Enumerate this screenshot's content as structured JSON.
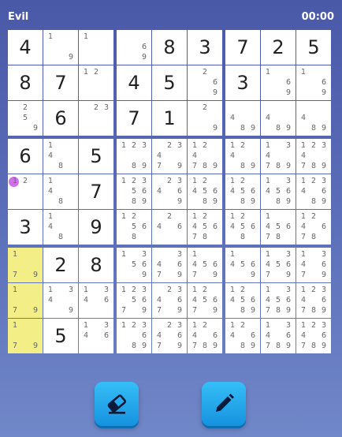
{
  "header": {
    "title": "Evil",
    "timer": "00:00"
  },
  "board": {
    "rows": [
      [
        {
          "v": "4"
        },
        {
          "c": [
            "1",
            "9"
          ]
        },
        {
          "c": [
            "1"
          ]
        },
        {
          "c": [
            "6",
            "9"
          ]
        },
        {
          "v": "8"
        },
        {
          "v": "3"
        },
        {
          "v": "7"
        },
        {
          "v": "2"
        },
        {
          "v": "5"
        }
      ],
      [
        {
          "v": "8"
        },
        {
          "v": "7"
        },
        {
          "c": [
            "1",
            "2"
          ]
        },
        {
          "v": "4"
        },
        {
          "v": "5"
        },
        {
          "c": [
            "2",
            "6",
            "9"
          ]
        },
        {
          "v": "3"
        },
        {
          "c": [
            "1",
            "6",
            "9"
          ]
        },
        {
          "c": [
            "1",
            "6",
            "9"
          ]
        }
      ],
      [
        {
          "c": [
            "2",
            "5",
            "9"
          ]
        },
        {
          "v": "6"
        },
        {
          "c": [
            "2",
            "3"
          ]
        },
        {
          "v": "7"
        },
        {
          "v": "1"
        },
        {
          "c": [
            "2",
            "9"
          ]
        },
        {
          "c": [
            "4",
            "8",
            "9"
          ]
        },
        {
          "c": [
            "4",
            "8",
            "9"
          ]
        },
        {
          "c": [
            "4",
            "8",
            "9"
          ]
        }
      ],
      [
        {
          "v": "6"
        },
        {
          "c": [
            "1",
            "4",
            "8"
          ]
        },
        {
          "v": "5"
        },
        {
          "c": [
            "1",
            "2",
            "3",
            "8",
            "9"
          ]
        },
        {
          "c": [
            "2",
            "3",
            "4",
            "7",
            "9"
          ]
        },
        {
          "c": [
            "1",
            "2",
            "4",
            "7",
            "8",
            "9"
          ]
        },
        {
          "c": [
            "1",
            "2",
            "4",
            "8",
            "9"
          ]
        },
        {
          "c": [
            "1",
            "3",
            "4",
            "7",
            "8",
            "9"
          ]
        },
        {
          "c": [
            "1",
            "2",
            "3",
            "4",
            "7",
            "8",
            "9"
          ]
        }
      ],
      [
        {
          "c": [
            "1",
            "2"
          ],
          "marker": true
        },
        {
          "c": [
            "1",
            "4",
            "8"
          ]
        },
        {
          "v": "7"
        },
        {
          "c": [
            "1",
            "2",
            "3",
            "5",
            "6",
            "8",
            "9"
          ]
        },
        {
          "c": [
            "2",
            "3",
            "4",
            "6",
            "9"
          ]
        },
        {
          "c": [
            "1",
            "2",
            "4",
            "5",
            "6",
            "8",
            "9"
          ]
        },
        {
          "c": [
            "1",
            "2",
            "4",
            "5",
            "6",
            "8",
            "9"
          ]
        },
        {
          "c": [
            "1",
            "3",
            "4",
            "5",
            "6",
            "8",
            "9"
          ]
        },
        {
          "c": [
            "1",
            "2",
            "3",
            "4",
            "6",
            "8",
            "9"
          ]
        }
      ],
      [
        {
          "v": "3"
        },
        {
          "c": [
            "1",
            "4",
            "8"
          ]
        },
        {
          "v": "9"
        },
        {
          "c": [
            "1",
            "2",
            "5",
            "6",
            "8"
          ]
        },
        {
          "c": [
            "2",
            "4",
            "6"
          ]
        },
        {
          "c": [
            "1",
            "2",
            "4",
            "5",
            "6",
            "7",
            "8"
          ]
        },
        {
          "c": [
            "1",
            "2",
            "4",
            "5",
            "6",
            "8"
          ]
        },
        {
          "c": [
            "1",
            "4",
            "5",
            "6",
            "7",
            "8"
          ]
        },
        {
          "c": [
            "1",
            "2",
            "4",
            "6",
            "7",
            "8"
          ]
        }
      ],
      [
        {
          "c": [
            "1",
            "7",
            "9"
          ],
          "hl": true
        },
        {
          "v": "2"
        },
        {
          "v": "8"
        },
        {
          "c": [
            "1",
            "3",
            "5",
            "6",
            "9"
          ]
        },
        {
          "c": [
            "3",
            "4",
            "6",
            "7",
            "9"
          ]
        },
        {
          "c": [
            "1",
            "4",
            "5",
            "6",
            "7",
            "9"
          ]
        },
        {
          "c": [
            "1",
            "4",
            "5",
            "6",
            "9"
          ]
        },
        {
          "c": [
            "1",
            "3",
            "4",
            "5",
            "6",
            "7",
            "9"
          ]
        },
        {
          "c": [
            "1",
            "3",
            "4",
            "6",
            "7",
            "9"
          ]
        }
      ],
      [
        {
          "c": [
            "1",
            "7",
            "9"
          ],
          "hl": true
        },
        {
          "c": [
            "1",
            "3",
            "4",
            "9"
          ]
        },
        {
          "c": [
            "1",
            "3",
            "4",
            "6"
          ]
        },
        {
          "c": [
            "1",
            "2",
            "3",
            "5",
            "6",
            "7",
            "9"
          ]
        },
        {
          "c": [
            "2",
            "3",
            "4",
            "6",
            "7",
            "9"
          ]
        },
        {
          "c": [
            "1",
            "2",
            "4",
            "5",
            "6",
            "7",
            "9"
          ]
        },
        {
          "c": [
            "1",
            "2",
            "4",
            "5",
            "6",
            "8",
            "9"
          ]
        },
        {
          "c": [
            "1",
            "3",
            "4",
            "5",
            "6",
            "7",
            "8",
            "9"
          ]
        },
        {
          "c": [
            "1",
            "2",
            "3",
            "4",
            "6",
            "7",
            "8",
            "9"
          ]
        }
      ],
      [
        {
          "c": [
            "1",
            "7",
            "9"
          ],
          "hl": true
        },
        {
          "v": "5"
        },
        {
          "c": [
            "1",
            "3",
            "4",
            "6"
          ]
        },
        {
          "c": [
            "1",
            "2",
            "3",
            "6",
            "8",
            "9"
          ]
        },
        {
          "c": [
            "2",
            "3",
            "4",
            "6",
            "7",
            "9"
          ]
        },
        {
          "c": [
            "1",
            "2",
            "4",
            "6",
            "7",
            "8",
            "9"
          ]
        },
        {
          "c": [
            "1",
            "2",
            "4",
            "6",
            "8",
            "9"
          ]
        },
        {
          "c": [
            "1",
            "3",
            "4",
            "6",
            "7",
            "8",
            "9"
          ]
        },
        {
          "c": [
            "1",
            "2",
            "3",
            "4",
            "6",
            "7",
            "8",
            "9"
          ]
        }
      ]
    ]
  },
  "controls": {
    "eraser_icon": "eraser-icon",
    "pencil_icon": "pencil-icon",
    "button_color": "#1ea8ee"
  },
  "colors": {
    "highlight": "#f3ee86",
    "marker": "#d070e8",
    "background_top": "#4a58a8"
  }
}
